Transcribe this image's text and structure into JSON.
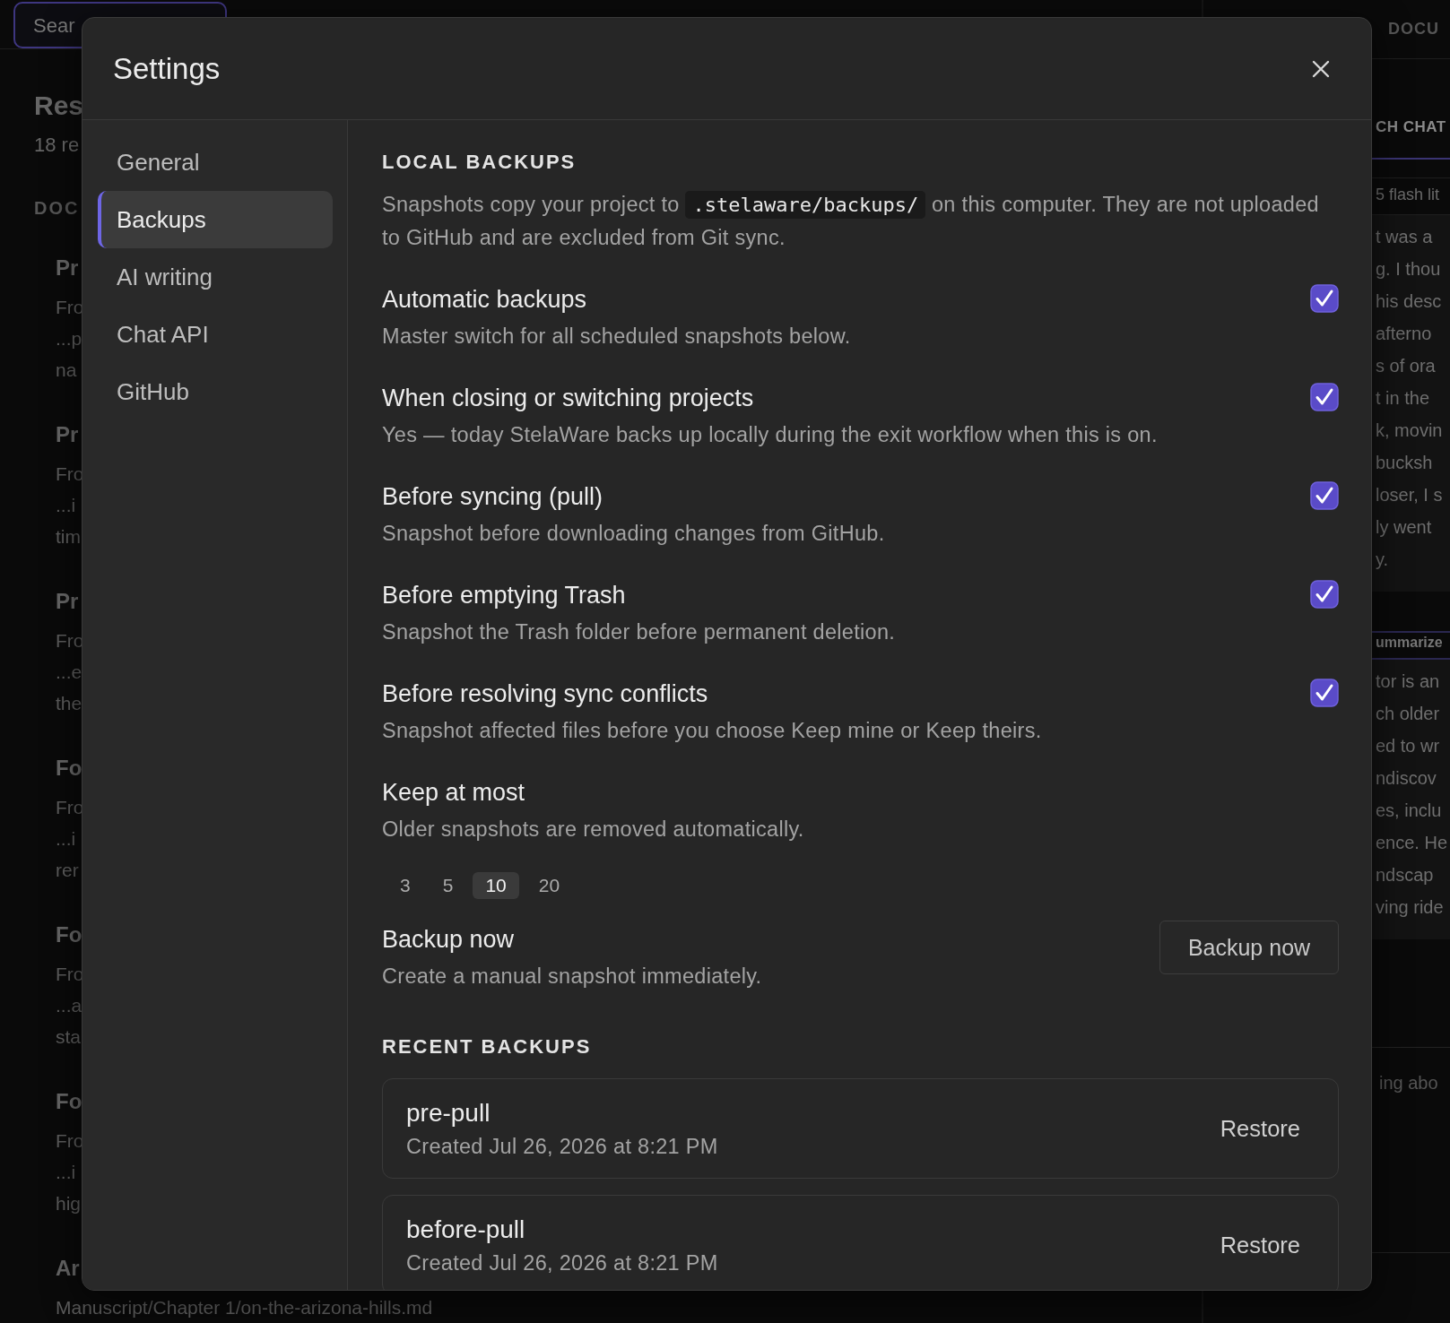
{
  "background": {
    "search_field": {
      "value": "Sear"
    },
    "left_panel": {
      "title": "Res",
      "count": "18 re",
      "section": "DOC",
      "results": [
        {
          "title": "Pr",
          "lines": [
            "Fro",
            "...p",
            "na"
          ]
        },
        {
          "title": "Pr",
          "lines": [
            "Fro",
            "...i",
            "tim"
          ]
        },
        {
          "title": "Pr",
          "lines": [
            "Fro",
            "...e",
            "the"
          ]
        },
        {
          "title": "Fo",
          "lines": [
            "Fro",
            "...i",
            "rer"
          ]
        },
        {
          "title": "Fo",
          "lines": [
            "Fro",
            "...a",
            "sta"
          ]
        },
        {
          "title": "Fo",
          "lines": [
            "Fro",
            "...i",
            "hig"
          ]
        },
        {
          "title": "Ar",
          "lines": [
            "Manuscript/Chapter 1/on-the-arizona-hills.md"
          ]
        }
      ]
    },
    "right_panel": {
      "tab": "DOCU",
      "heading": "CH CHAT",
      "model": "5 flash lit",
      "messages": [
        {
          "lines": [
            "t was a",
            "g. I thou",
            "his desc",
            "afterno",
            "s of ora",
            "t in the",
            "k, movin",
            "bucksh",
            "loser, I s",
            "ly went",
            "y."
          ]
        },
        {
          "label": "ummarize",
          "lines": [
            "tor is an",
            "ch older",
            "ed to wr",
            "ndiscov",
            "es, inclu",
            "ence. He",
            "ndscap",
            "ving ride"
          ]
        }
      ],
      "composer_placeholder": "ing abo"
    }
  },
  "dialog": {
    "title": "Settings",
    "sidebar": [
      {
        "label": "General",
        "selected": false
      },
      {
        "label": "Backups",
        "selected": true
      },
      {
        "label": "AI writing",
        "selected": false
      },
      {
        "label": "Chat API",
        "selected": false
      },
      {
        "label": "GitHub",
        "selected": false
      }
    ],
    "section_title": "LOCAL BACKUPS",
    "description": {
      "before": "Snapshots copy your project to",
      "code": ".stelaware/backups/",
      "after": "on this computer. They are not uploaded to GitHub and are excluded from Git sync."
    },
    "settings": [
      {
        "title": "Automatic backups",
        "description": "Master switch for all scheduled snapshots below.",
        "checked": true
      },
      {
        "title": "When closing or switching projects",
        "description": "Yes — today StelaWare backs up locally during the exit workflow when this is on.",
        "checked": true
      },
      {
        "title": "Before syncing (pull)",
        "description": "Snapshot before downloading changes from GitHub.",
        "checked": true
      },
      {
        "title": "Before emptying Trash",
        "description": "Snapshot the Trash folder before permanent deletion.",
        "checked": true
      },
      {
        "title": "Before resolving sync conflicts",
        "description": "Snapshot affected files before you choose Keep mine or Keep theirs.",
        "checked": true
      }
    ],
    "keep": {
      "title": "Keep at most",
      "description": "Older snapshots are removed automatically.",
      "options": [
        {
          "label": "3",
          "selected": false
        },
        {
          "label": "5",
          "selected": false
        },
        {
          "label": "10",
          "selected": true
        },
        {
          "label": "20",
          "selected": false
        }
      ]
    },
    "backup_now": {
      "title": "Backup now",
      "description": "Create a manual snapshot immediately.",
      "button": "Backup now"
    },
    "recent_title": "RECENT BACKUPS",
    "recent": [
      {
        "name": "pre-pull",
        "created": "Created Jul 26, 2026 at 8:21 PM",
        "action": "Restore"
      },
      {
        "name": "before-pull",
        "created": "Created Jul 26, 2026 at 8:21 PM",
        "action": "Restore"
      }
    ]
  }
}
